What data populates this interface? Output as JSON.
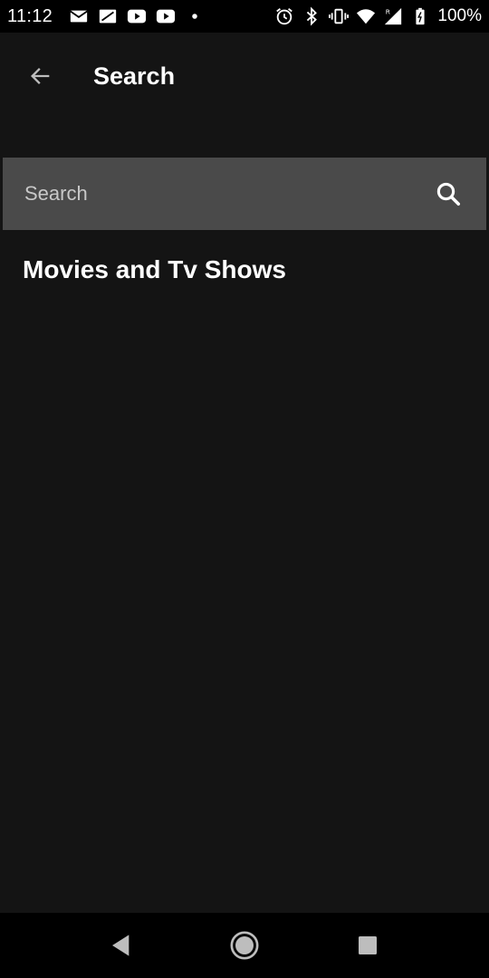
{
  "status_bar": {
    "time": "11:12",
    "battery": "100%",
    "left_icons": [
      "gmail-icon",
      "image-icon",
      "youtube-icon",
      "youtube-icon",
      "dot-icon"
    ],
    "right_icons": [
      "alarm-icon",
      "bluetooth-icon",
      "vibrate-icon",
      "wifi-icon",
      "signal-icon",
      "battery-icon"
    ]
  },
  "app_bar": {
    "title": "Search"
  },
  "search": {
    "placeholder": "Search",
    "value": ""
  },
  "content": {
    "section_heading": "Movies and Tv Shows"
  },
  "colors": {
    "background": "#141414",
    "search_field": "#4a4a4a",
    "status_bar": "#000000",
    "text": "#ffffff"
  }
}
